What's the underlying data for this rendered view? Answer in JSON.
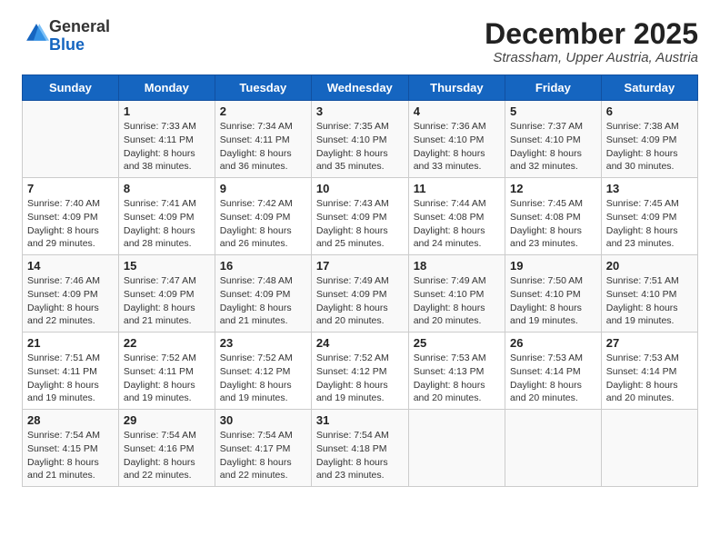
{
  "header": {
    "logo_line1": "General",
    "logo_line2": "Blue",
    "month": "December 2025",
    "location": "Strassham, Upper Austria, Austria"
  },
  "weekdays": [
    "Sunday",
    "Monday",
    "Tuesday",
    "Wednesday",
    "Thursday",
    "Friday",
    "Saturday"
  ],
  "weeks": [
    [
      {
        "day": "",
        "info": ""
      },
      {
        "day": "1",
        "info": "Sunrise: 7:33 AM\nSunset: 4:11 PM\nDaylight: 8 hours\nand 38 minutes."
      },
      {
        "day": "2",
        "info": "Sunrise: 7:34 AM\nSunset: 4:11 PM\nDaylight: 8 hours\nand 36 minutes."
      },
      {
        "day": "3",
        "info": "Sunrise: 7:35 AM\nSunset: 4:10 PM\nDaylight: 8 hours\nand 35 minutes."
      },
      {
        "day": "4",
        "info": "Sunrise: 7:36 AM\nSunset: 4:10 PM\nDaylight: 8 hours\nand 33 minutes."
      },
      {
        "day": "5",
        "info": "Sunrise: 7:37 AM\nSunset: 4:10 PM\nDaylight: 8 hours\nand 32 minutes."
      },
      {
        "day": "6",
        "info": "Sunrise: 7:38 AM\nSunset: 4:09 PM\nDaylight: 8 hours\nand 30 minutes."
      }
    ],
    [
      {
        "day": "7",
        "info": "Sunrise: 7:40 AM\nSunset: 4:09 PM\nDaylight: 8 hours\nand 29 minutes."
      },
      {
        "day": "8",
        "info": "Sunrise: 7:41 AM\nSunset: 4:09 PM\nDaylight: 8 hours\nand 28 minutes."
      },
      {
        "day": "9",
        "info": "Sunrise: 7:42 AM\nSunset: 4:09 PM\nDaylight: 8 hours\nand 26 minutes."
      },
      {
        "day": "10",
        "info": "Sunrise: 7:43 AM\nSunset: 4:09 PM\nDaylight: 8 hours\nand 25 minutes."
      },
      {
        "day": "11",
        "info": "Sunrise: 7:44 AM\nSunset: 4:08 PM\nDaylight: 8 hours\nand 24 minutes."
      },
      {
        "day": "12",
        "info": "Sunrise: 7:45 AM\nSunset: 4:08 PM\nDaylight: 8 hours\nand 23 minutes."
      },
      {
        "day": "13",
        "info": "Sunrise: 7:45 AM\nSunset: 4:09 PM\nDaylight: 8 hours\nand 23 minutes."
      }
    ],
    [
      {
        "day": "14",
        "info": "Sunrise: 7:46 AM\nSunset: 4:09 PM\nDaylight: 8 hours\nand 22 minutes."
      },
      {
        "day": "15",
        "info": "Sunrise: 7:47 AM\nSunset: 4:09 PM\nDaylight: 8 hours\nand 21 minutes."
      },
      {
        "day": "16",
        "info": "Sunrise: 7:48 AM\nSunset: 4:09 PM\nDaylight: 8 hours\nand 21 minutes."
      },
      {
        "day": "17",
        "info": "Sunrise: 7:49 AM\nSunset: 4:09 PM\nDaylight: 8 hours\nand 20 minutes."
      },
      {
        "day": "18",
        "info": "Sunrise: 7:49 AM\nSunset: 4:10 PM\nDaylight: 8 hours\nand 20 minutes."
      },
      {
        "day": "19",
        "info": "Sunrise: 7:50 AM\nSunset: 4:10 PM\nDaylight: 8 hours\nand 19 minutes."
      },
      {
        "day": "20",
        "info": "Sunrise: 7:51 AM\nSunset: 4:10 PM\nDaylight: 8 hours\nand 19 minutes."
      }
    ],
    [
      {
        "day": "21",
        "info": "Sunrise: 7:51 AM\nSunset: 4:11 PM\nDaylight: 8 hours\nand 19 minutes."
      },
      {
        "day": "22",
        "info": "Sunrise: 7:52 AM\nSunset: 4:11 PM\nDaylight: 8 hours\nand 19 minutes."
      },
      {
        "day": "23",
        "info": "Sunrise: 7:52 AM\nSunset: 4:12 PM\nDaylight: 8 hours\nand 19 minutes."
      },
      {
        "day": "24",
        "info": "Sunrise: 7:52 AM\nSunset: 4:12 PM\nDaylight: 8 hours\nand 19 minutes."
      },
      {
        "day": "25",
        "info": "Sunrise: 7:53 AM\nSunset: 4:13 PM\nDaylight: 8 hours\nand 20 minutes."
      },
      {
        "day": "26",
        "info": "Sunrise: 7:53 AM\nSunset: 4:14 PM\nDaylight: 8 hours\nand 20 minutes."
      },
      {
        "day": "27",
        "info": "Sunrise: 7:53 AM\nSunset: 4:14 PM\nDaylight: 8 hours\nand 20 minutes."
      }
    ],
    [
      {
        "day": "28",
        "info": "Sunrise: 7:54 AM\nSunset: 4:15 PM\nDaylight: 8 hours\nand 21 minutes."
      },
      {
        "day": "29",
        "info": "Sunrise: 7:54 AM\nSunset: 4:16 PM\nDaylight: 8 hours\nand 22 minutes."
      },
      {
        "day": "30",
        "info": "Sunrise: 7:54 AM\nSunset: 4:17 PM\nDaylight: 8 hours\nand 22 minutes."
      },
      {
        "day": "31",
        "info": "Sunrise: 7:54 AM\nSunset: 4:18 PM\nDaylight: 8 hours\nand 23 minutes."
      },
      {
        "day": "",
        "info": ""
      },
      {
        "day": "",
        "info": ""
      },
      {
        "day": "",
        "info": ""
      }
    ]
  ]
}
